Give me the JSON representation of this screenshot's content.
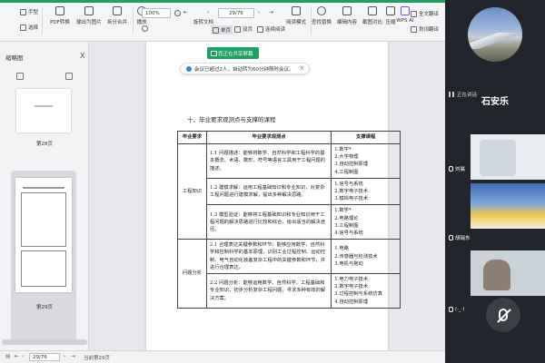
{
  "toolbar": {
    "hand": "手型",
    "select": "选择",
    "pdf_convert": "PDF转换",
    "export_image": "输出为图片",
    "split_merge": "拆分合并",
    "play": "播放",
    "zoom": "100%",
    "page_box": "29/76",
    "rotate_doc": "旋转文档",
    "single_page": "单页",
    "double_page": "双页",
    "continuous": "连续阅读",
    "read_mode": "阅读模式",
    "find_replace": "查找替换",
    "edit_content": "编辑内容",
    "screenshot_compare": "截图对比",
    "compress": "压缩",
    "wps_ai": "WPS AI",
    "full_translate": "全文翻译",
    "draw_translate": "划词翻译"
  },
  "left_panel": {
    "title": "缩略图",
    "close": "X",
    "thumb1_label": "第28页",
    "thumb2_label": "第29页"
  },
  "meeting": {
    "sharing": "您正在共享屏幕",
    "notice": "会议已超过2人，自动转为60分钟限时会议。",
    "notice_close": "X"
  },
  "document": {
    "heading": "十、毕业要求观测点与支撑的课程",
    "headers": [
      "毕业要求",
      "毕业要求观测点",
      "支撑课程"
    ],
    "groups": [
      {
        "name": "工程知识",
        "rows": [
          {
            "point": "1.1 问题描述：能够将数学、自然科学和工程科学的基本概念、术语、数形、符号等语言工具用于工程问题的描述。",
            "courses": [
              "1.数学*",
              "2.大学物理",
              "3.自动控制原理",
              "4.工程制图"
            ]
          },
          {
            "point": "1.2 建模求解：运用工程基础知识和专业知识，对复杂工程问题进行建模求解，提出多种解决思路。",
            "courses": [
              "1.信号与系统",
              "2.数字电子技术",
              "3.模拟电子技术"
            ]
          },
          {
            "point": "1.3 模型验证：能够将工程基础知识和专业知识用于工程问题的解决思路进行比较和综合，给出适当的解决途径。",
            "courses": [
              "1.数学*",
              "2.电路理论",
              "3.工程制图",
              "4.信号与系统"
            ]
          }
        ]
      },
      {
        "name": "问题分析",
        "rows": [
          {
            "point": "2.1 合理表达关键参数和环节：能够应用数学、自然科学和控制科学的基本原理，识别工业过程控制、运动控制、电气自动化装备复杂工程中的关键参数和环节，并进行合理表达。",
            "courses": [
              "1.电路",
              "2.传感器与检测技术",
              "3.电机与拖动"
            ]
          },
          {
            "point": "2.2 问题分析：能够运用数学、自然科学、工程基础和专业知识，初步分析复杂工程问题，寻求多种有效的解决方案。",
            "courses": [
              "1.电力电子技术",
              "2.数字电子技术",
              "3.过程控制与系统仿真",
              "4.自动控制原理"
            ]
          }
        ]
      }
    ]
  },
  "statusbar": {
    "page_value": "29/76",
    "page_info": "当前第29页"
  },
  "video": {
    "main_name": "石安乐",
    "speaking": "正在讲话",
    "p1": "刘晨",
    "p2": "胡瑞东",
    "p3": "(·_·)"
  }
}
